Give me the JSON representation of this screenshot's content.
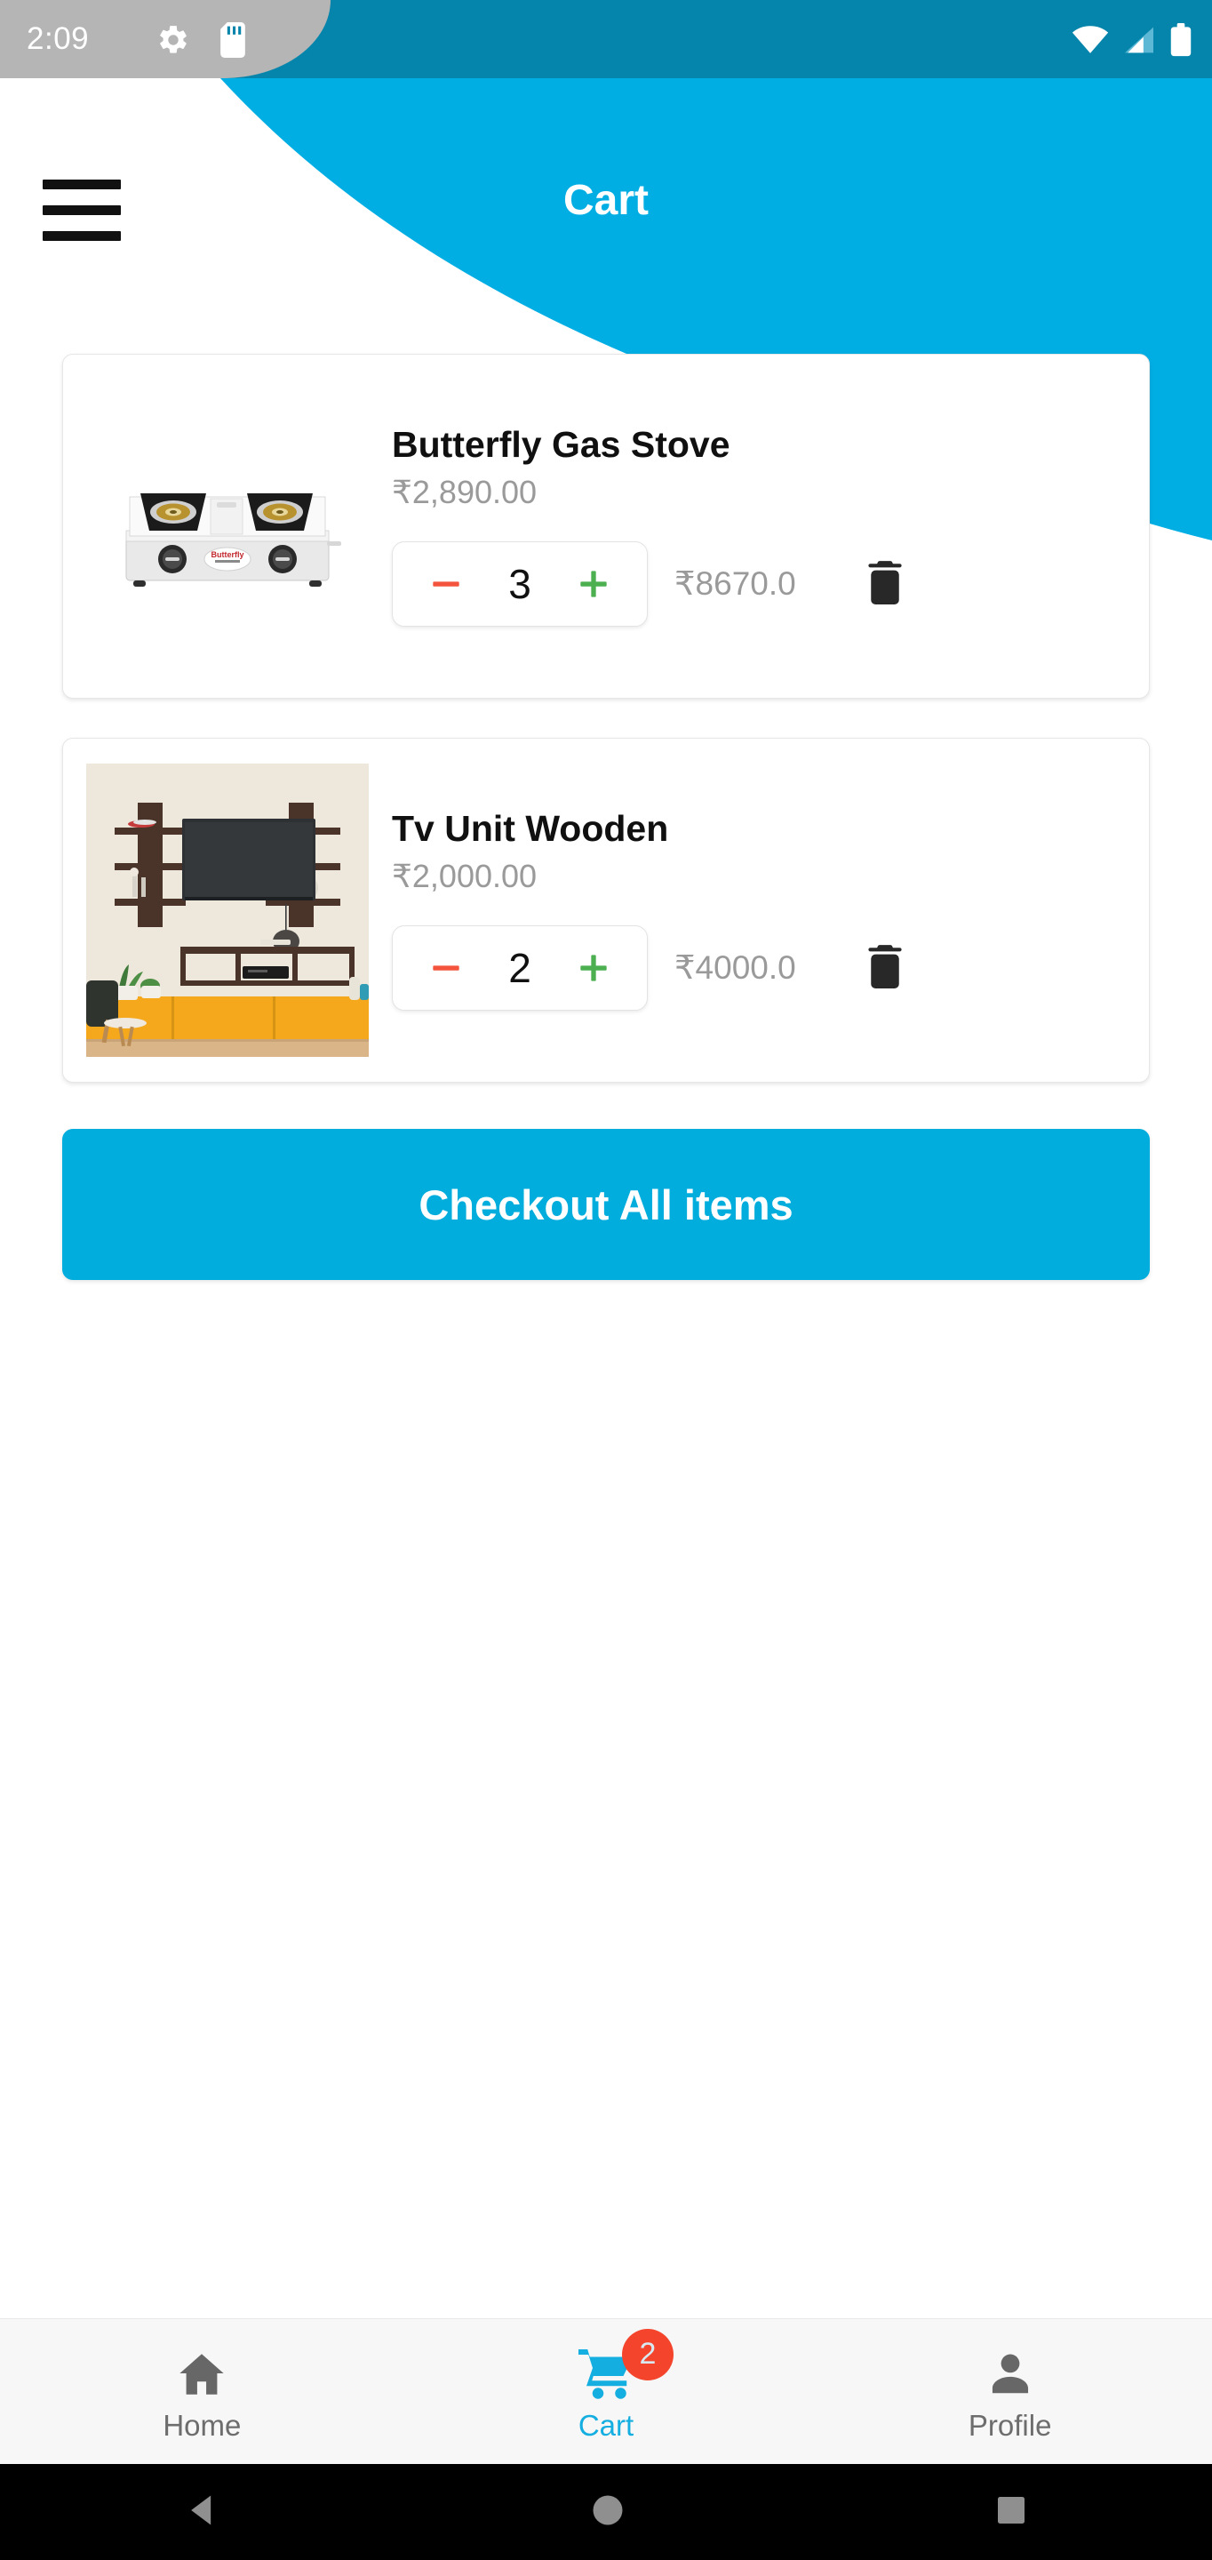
{
  "status_bar": {
    "time": "2:09",
    "icons_left": [
      "gear-icon",
      "sd-card-icon"
    ],
    "icons_right": [
      "wifi-icon",
      "cellular-signal-icon",
      "battery-icon"
    ],
    "bg_color": "#0585ab",
    "shade_color": "#b5b5b5"
  },
  "app_bar": {
    "title": "Cart",
    "menu_icon": "hamburger-menu-icon",
    "accent_color": "#00AEE4"
  },
  "cart": {
    "items": [
      {
        "name": "Butterfly Gas Stove",
        "unit_price": "₹2,890.00",
        "quantity": "3",
        "line_total": "₹8670.0",
        "image": "gas-stove-photo",
        "decrement_label": "−",
        "increment_label": "+",
        "delete_icon": "trash-icon"
      },
      {
        "name": "Tv Unit Wooden",
        "unit_price": "₹2,000.00",
        "quantity": "2",
        "line_total": "₹4000.0",
        "image": "tv-unit-photo",
        "decrement_label": "−",
        "increment_label": "+",
        "delete_icon": "trash-icon"
      }
    ],
    "checkout_label": "Checkout All items",
    "checkout_color": "#00ADDC"
  },
  "bottom_nav": {
    "items": [
      {
        "label": "Home",
        "icon": "home-icon",
        "active": false,
        "badge": ""
      },
      {
        "label": "Cart",
        "icon": "cart-icon",
        "active": true,
        "badge": "2"
      },
      {
        "label": "Profile",
        "icon": "person-icon",
        "active": false,
        "badge": ""
      }
    ],
    "active_color": "#14AEE0",
    "inactive_color": "#6d6d6d",
    "badge_color": "#F4452C"
  },
  "android_nav": {
    "back": "back-triangle-icon",
    "home": "home-circle-icon",
    "recents": "recents-square-icon"
  }
}
